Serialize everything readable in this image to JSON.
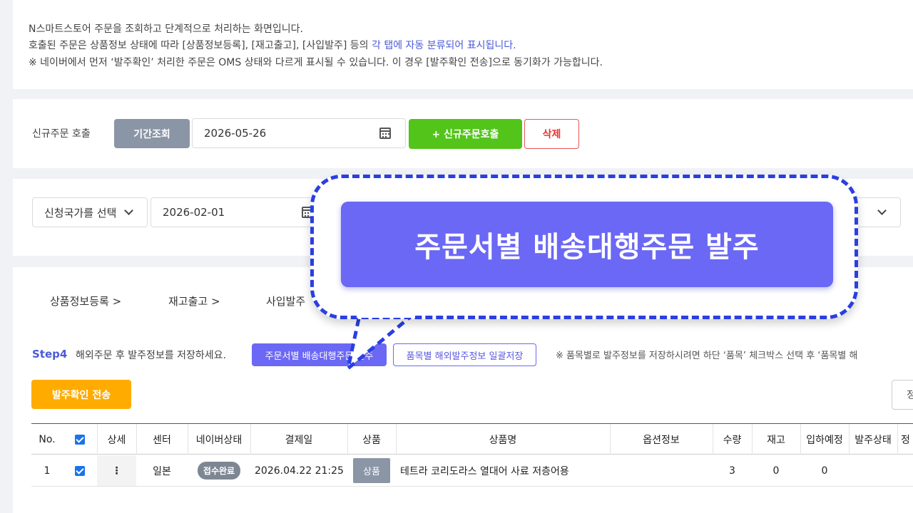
{
  "info": {
    "line1": "N스마트스토어 주문을 조회하고 단계적으로 처리하는 화면입니다.",
    "line2_pre": "호출된 주문은 상품정보 상태에 따라 [상품정보등록], [재고출고], [사입발주] 등의 ",
    "line2_highlight": "각 탭에 자동 분류되어 표시됩니다.",
    "line3": "※ 네이버에서 먼저 ‘발주확인’ 처리한 주문은 OMS 상태와 다르게 표시될 수 있습니다. 이 경우 [발주확인 전송]으로 동기화가 가능합니다."
  },
  "call": {
    "label": "신규주문 호출",
    "period_button": "기간조회",
    "date": "2026-05-26",
    "new_order_button": "+ 신규주문호출",
    "delete_button": "삭제"
  },
  "filter": {
    "country_select": "신청국가를 선택",
    "date_from": "2026-02-01"
  },
  "tabs": [
    "상품정보등록  >",
    "재고출고  >",
    "사입발주"
  ],
  "step": {
    "label": "Step4",
    "description": "해외주문 후 발주정보를 저장하세요.",
    "order_button": "주문서별 배송대행주문 발주",
    "bulk_button": "품목별 해외발주정보 일괄저장",
    "note": "※ 품목별로 발주정보를 저장하시려면 하단 ‘품목’ 체크박스 선택 후 ‘품목별 해"
  },
  "confirm_button": "발주확인 전송",
  "right_button": "정",
  "table": {
    "headers": [
      "No.",
      "",
      "상세",
      "센터",
      "네이버상태",
      "결제일",
      "상품",
      "상품명",
      "옵션정보",
      "수량",
      "재고",
      "입하예정",
      "발주상태",
      "정"
    ],
    "rows": [
      {
        "no": "1",
        "detail": "⋮",
        "center": "일본",
        "status": "접수완료",
        "paid": "2026.04.22 21:25",
        "type": "상품",
        "name": "테트라 코리도라스 열대어 사료 저층어용",
        "option": "",
        "qty": "3",
        "stock": "0",
        "incoming": "0",
        "order_status": "",
        "extra": ""
      }
    ]
  },
  "callout": {
    "text": "주문서별 배송대행주문 발주"
  },
  "colors": {
    "primary": "#6b68f5",
    "green": "#52c41a",
    "orange": "#ffab00",
    "gray_button": "#8a95a5",
    "dash": "#2a3fe0"
  }
}
